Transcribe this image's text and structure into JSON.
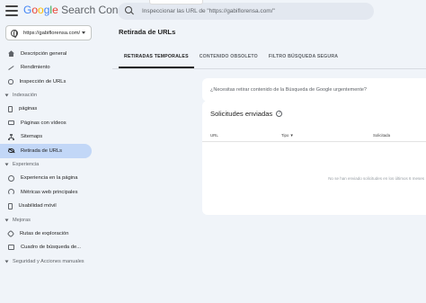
{
  "header": {
    "app_name_parts": [
      "G",
      "o",
      "o",
      "g",
      "l",
      "e"
    ],
    "app_name_rest": " Search Console",
    "search_placeholder": "Inspeccionar las URL de \"https://gabiflorensa.com/\""
  },
  "property": {
    "label": "https://gabiflorensa.com/"
  },
  "sidebar": {
    "top_items": [
      {
        "label": "Descripción general",
        "icon": "home-icon"
      },
      {
        "label": "Rendimiento",
        "icon": "trending-icon"
      },
      {
        "label": "Inspección de URLs",
        "icon": "search-icon"
      }
    ],
    "indexing": {
      "label": "Indexación",
      "items": [
        {
          "label": "páginas",
          "icon": "page-icon"
        },
        {
          "label": "Páginas con vídeos",
          "icon": "video-icon"
        },
        {
          "label": "Sitemaps",
          "icon": "sitemap-icon"
        },
        {
          "label": "Retirada de URLs",
          "icon": "eye-off-icon",
          "active": true
        }
      ]
    },
    "experience": {
      "label": "Experiencia",
      "items": [
        {
          "label": "Experiencia en la página",
          "icon": "gauge-icon"
        },
        {
          "label": "Métricas web principales",
          "icon": "speed-icon"
        },
        {
          "label": "Usabilidad móvil",
          "icon": "phone-icon"
        }
      ]
    },
    "enhancements": {
      "label": "Mejoras",
      "items": [
        {
          "label": "Rutas de exploración",
          "icon": "route-icon"
        },
        {
          "label": "Cuadro de búsqueda de...",
          "icon": "box-icon"
        }
      ]
    },
    "security": {
      "label": "Seguridad y Acciones manuales"
    }
  },
  "main": {
    "title": "Retirada de URLs",
    "tabs": [
      {
        "label": "RETIRADAS TEMPORALES",
        "active": true
      },
      {
        "label": "CONTENIDO OBSOLETO",
        "active": false
      },
      {
        "label": "FILTRO BÚSQUEDA SEGURA",
        "active": false
      }
    ],
    "urgent_prompt": "¿Necesitas retirar contenido de la Búsqueda de Google urgentemente?",
    "requests": {
      "title": "Solicitudes enviadas",
      "columns": [
        "URL",
        "Tipo",
        "Solicitada"
      ],
      "empty_text": "No se han enviado solicitudes en los últimos 6 meses"
    }
  }
}
